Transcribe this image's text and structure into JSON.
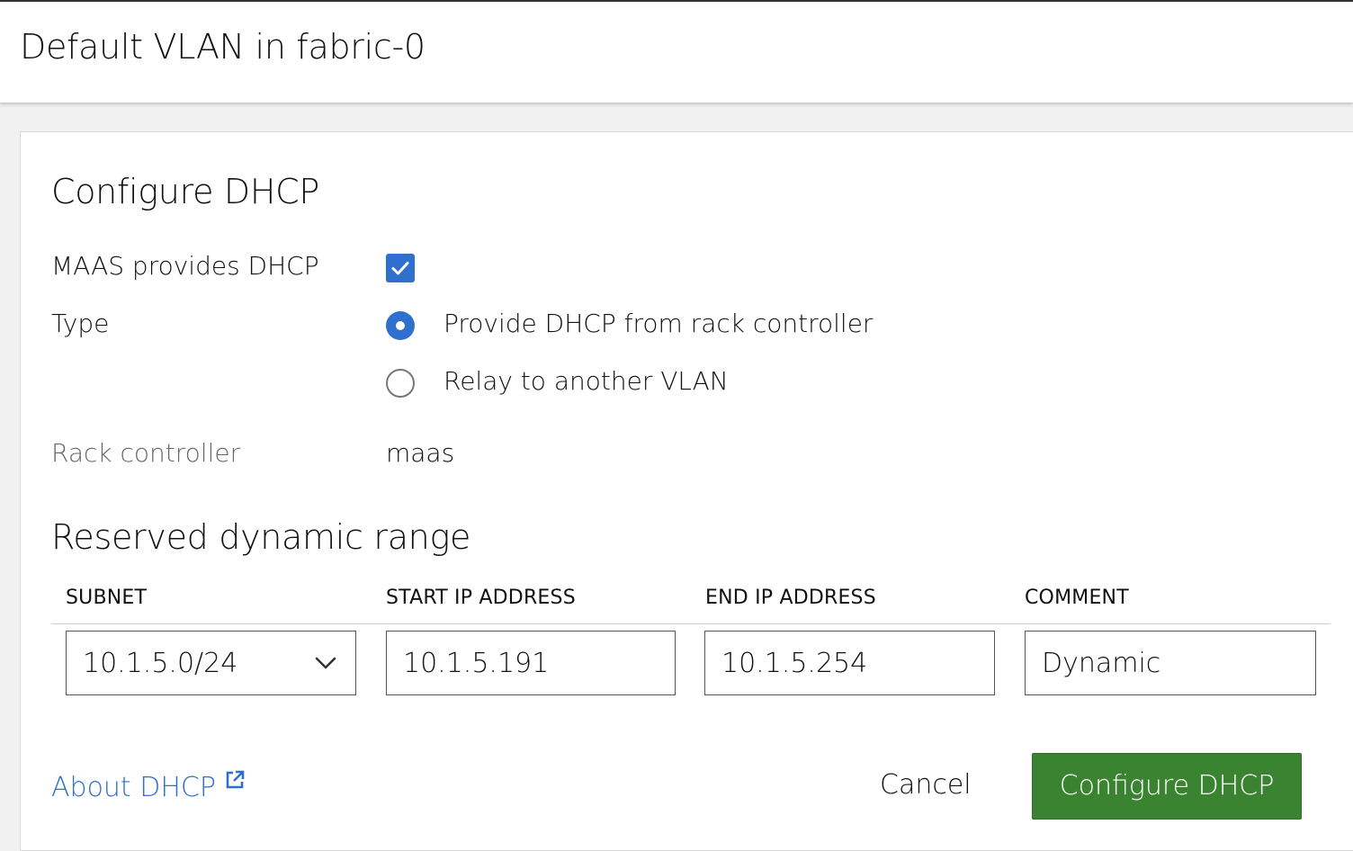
{
  "header": {
    "title": "Default VLAN in fabric-0"
  },
  "form": {
    "title": "Configure DHCP",
    "maas_provides_dhcp": {
      "label": "MAAS provides DHCP",
      "checked": true
    },
    "type": {
      "label": "Type",
      "options": [
        {
          "label": "Provide DHCP from rack controller",
          "selected": true
        },
        {
          "label": "Relay to another VLAN",
          "selected": false
        }
      ]
    },
    "rack_controller": {
      "label": "Rack controller",
      "value": "maas"
    }
  },
  "reserved_range": {
    "title": "Reserved dynamic range",
    "columns": [
      "SUBNET",
      "START IP ADDRESS",
      "END IP ADDRESS",
      "COMMENT"
    ],
    "row": {
      "subnet": "10.1.5.0/24",
      "start_ip": "10.1.5.191",
      "end_ip": "10.1.5.254",
      "comment": "Dynamic"
    }
  },
  "footer": {
    "about_link": "About DHCP",
    "cancel_label": "Cancel",
    "submit_label": "Configure DHCP"
  },
  "colors": {
    "accent": "#2f6fcd",
    "primary_button": "#3a8331",
    "link": "#2f6fcd"
  },
  "icons": {
    "checkbox": "check-icon",
    "select": "chevron-down-icon",
    "external_link": "external-link-icon"
  }
}
